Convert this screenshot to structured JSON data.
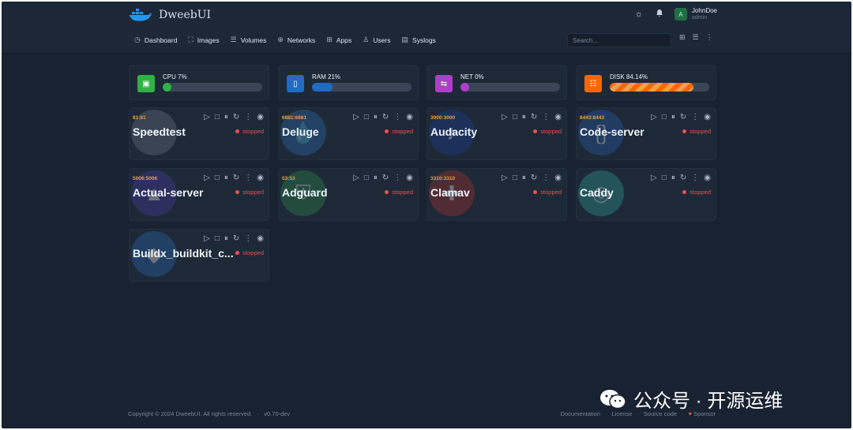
{
  "brand": {
    "name": "DweebUI"
  },
  "user": {
    "initial": "A",
    "name": "JohnDoe",
    "role": "admin"
  },
  "header_icons": {
    "theme": "sun-icon",
    "notifications": "bell-icon"
  },
  "nav": [
    {
      "label": "Dashboard",
      "icon": "dashboard-icon"
    },
    {
      "label": "Images",
      "icon": "images-icon"
    },
    {
      "label": "Volumes",
      "icon": "volumes-icon"
    },
    {
      "label": "Networks",
      "icon": "networks-icon"
    },
    {
      "label": "Apps",
      "icon": "apps-icon"
    },
    {
      "label": "Users",
      "icon": "users-icon"
    },
    {
      "label": "Syslogs",
      "icon": "syslogs-icon"
    }
  ],
  "search": {
    "placeholder": "Search..."
  },
  "stats": [
    {
      "label": "CPU 7%",
      "percent": 7,
      "color": "#2fb344"
    },
    {
      "label": "RAM 21%",
      "percent": 21,
      "color": "#206bc4"
    },
    {
      "label": "NET 0%",
      "percent": 0,
      "color": "#ae3ec9"
    },
    {
      "label": "DISK 84.14%",
      "percent": 84.14,
      "color": "#f76707"
    }
  ],
  "containers": [
    {
      "port": "81:81",
      "name": "Speedtest",
      "status": "stopped"
    },
    {
      "port": "6881:6881",
      "name": "Deluge",
      "status": "stopped"
    },
    {
      "port": "3000:3000",
      "name": "Audacity",
      "status": "stopped"
    },
    {
      "port": "8443:8443",
      "name": "Code-server",
      "status": "stopped"
    },
    {
      "port": "5006:5006",
      "name": "Actual-server",
      "status": "stopped"
    },
    {
      "port": "53:53",
      "name": "Adguard",
      "status": "stopped"
    },
    {
      "port": "3310:3310",
      "name": "Clamav",
      "status": "stopped"
    },
    {
      "port": "",
      "name": "Caddy",
      "status": "stopped"
    },
    {
      "port": "",
      "name": "Buildx_buildkit_c...",
      "status": "stopped"
    }
  ],
  "footer": {
    "copyright": "Copyright © 2024 DweebUI. All rights reserved.",
    "version": "v0.70-dev",
    "links": [
      "Documentation",
      "License",
      "Source code",
      "Sponsor"
    ]
  },
  "watermark": {
    "text": "公众号 · 开源运维"
  }
}
